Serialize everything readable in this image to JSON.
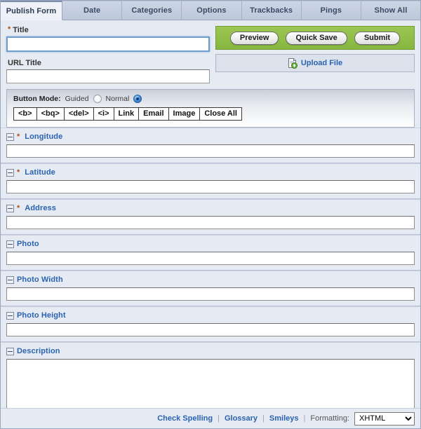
{
  "tabs": [
    {
      "label": "Publish Form",
      "active": true
    },
    {
      "label": "Date",
      "active": false
    },
    {
      "label": "Categories",
      "active": false
    },
    {
      "label": "Options",
      "active": false
    },
    {
      "label": "Trackbacks",
      "active": false
    },
    {
      "label": "Pings",
      "active": false
    },
    {
      "label": "Show All",
      "active": false
    }
  ],
  "top": {
    "title_label": "Title",
    "title_required": "*",
    "title_value": "",
    "url_title_label": "URL Title",
    "url_title_value": "",
    "actions": {
      "preview": "Preview",
      "quick_save": "Quick Save",
      "submit": "Submit",
      "bar_color": "#8dc048"
    },
    "upload": {
      "label": "Upload File",
      "icon": "document-upload-icon",
      "link_color": "#2a63b0"
    }
  },
  "button_mode": {
    "title": "Button Mode:",
    "options": [
      {
        "label": "Guided",
        "checked": false
      },
      {
        "label": "Normal",
        "checked": true
      }
    ],
    "buttons": [
      "<b>",
      "<bq>",
      "<del>",
      "<i>",
      "Link",
      "Email",
      "Image",
      "Close All"
    ]
  },
  "fields": [
    {
      "label": "Longitude",
      "required": true,
      "value": "",
      "type": "text"
    },
    {
      "label": "Latitude",
      "required": true,
      "value": "",
      "type": "text"
    },
    {
      "label": "Address",
      "required": true,
      "value": "",
      "type": "text"
    },
    {
      "label": "Photo",
      "required": false,
      "value": "",
      "type": "text"
    },
    {
      "label": "Photo Width",
      "required": false,
      "value": "",
      "type": "text"
    },
    {
      "label": "Photo Height",
      "required": false,
      "value": "",
      "type": "text"
    },
    {
      "label": "Description",
      "required": false,
      "value": "",
      "type": "textarea"
    }
  ],
  "footer": {
    "check_spelling": "Check Spelling",
    "glossary": "Glossary",
    "smileys": "Smileys",
    "separator": "|",
    "formatting_label": "Formatting:",
    "formatting_value": "XHTML",
    "formatting_options": [
      "XHTML"
    ]
  },
  "colors": {
    "label_blue": "#2a63b0",
    "required_star": "#a8521b",
    "action_green": "#8dc048",
    "page_bg": "#e6eaf2"
  }
}
